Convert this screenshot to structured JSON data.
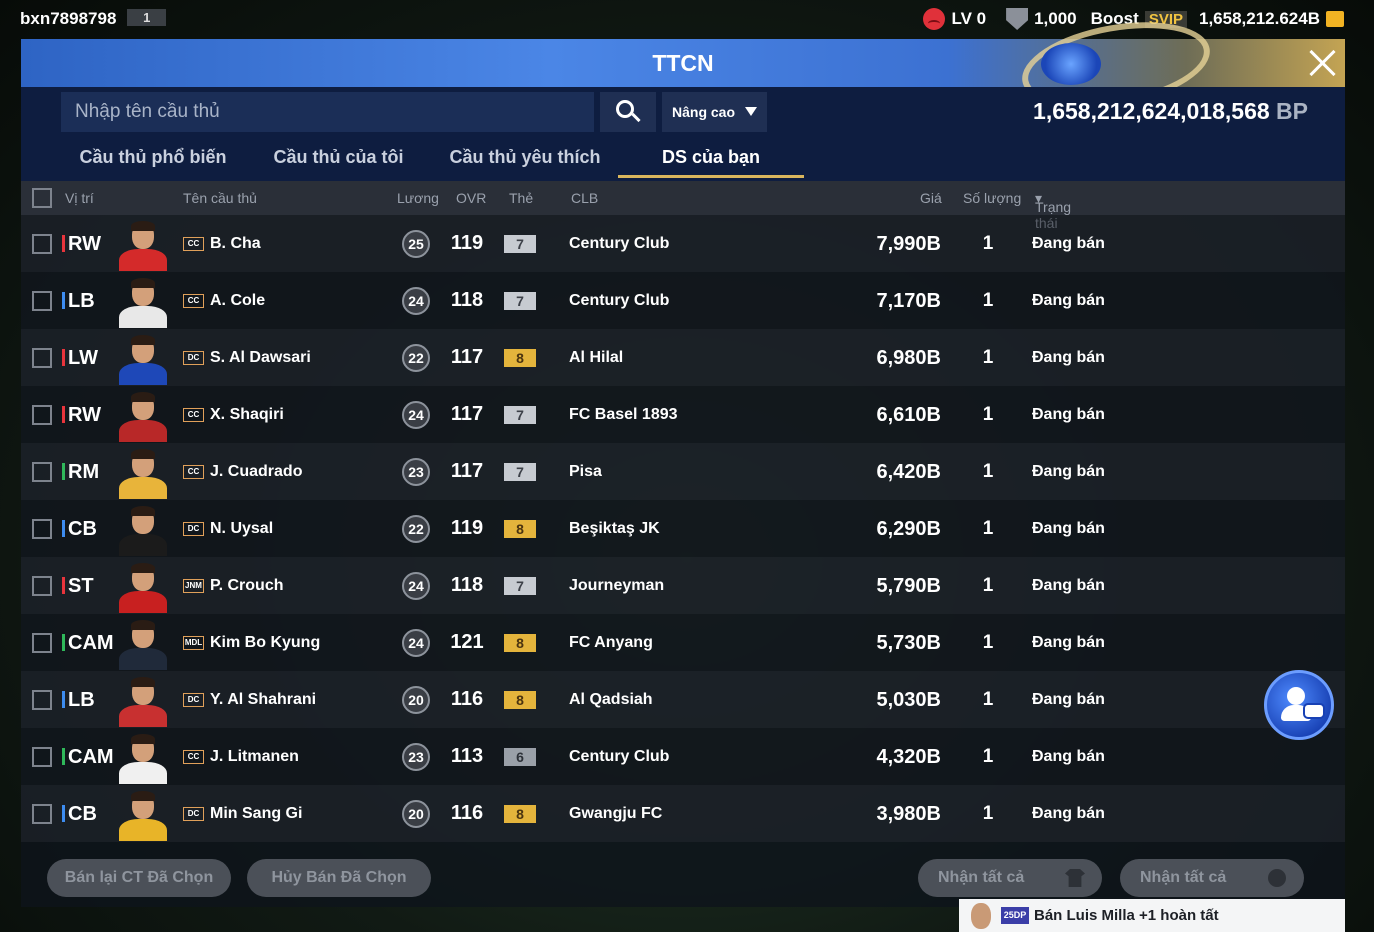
{
  "topbar": {
    "username": "bxn7898798",
    "user_badge": "1",
    "level": "LV 0",
    "shield_value": "1,000",
    "boost_label": "Boost",
    "svip_label": "SVIP",
    "currency": "1,658,212.624B"
  },
  "window": {
    "title": "TTCN"
  },
  "search": {
    "placeholder": "Nhập tên cầu thủ",
    "advanced_label": "Nâng cao",
    "bp_value": "1,658,212,624,018,568",
    "bp_unit": "BP"
  },
  "tabs": [
    {
      "label": "Cầu thủ phổ biến"
    },
    {
      "label": "Cầu thủ của tôi"
    },
    {
      "label": "Cầu thủ yêu thích"
    },
    {
      "label": "DS của bạn"
    }
  ],
  "columns": {
    "position": "Vị trí",
    "name": "Tên cầu thủ",
    "salary": "Lương",
    "ovr": "OVR",
    "grade": "Thẻ",
    "club": "CLB",
    "price": "Giá",
    "quantity": "Số lượng",
    "status": "Trạng thái"
  },
  "colors": {
    "attack": "#e8343c",
    "defense": "#3d8cf0",
    "midfield": "#2fb85a",
    "accent_gold": "#d9b65d"
  },
  "rows": [
    {
      "position": "RW",
      "pos_group": "attack",
      "season": "CC",
      "name": "B. Cha",
      "salary": "25",
      "ovr": "119",
      "grade": "7",
      "grade_color": "silver",
      "club": "Century Club",
      "price": "7,990B",
      "quantity": "1",
      "status": "Đang bán",
      "kit": "#d42a2a"
    },
    {
      "position": "LB",
      "pos_group": "defense",
      "season": "CC",
      "name": "A. Cole",
      "salary": "24",
      "ovr": "118",
      "grade": "7",
      "grade_color": "silver",
      "club": "Century Club",
      "price": "7,170B",
      "quantity": "1",
      "status": "Đang bán",
      "kit": "#e8e8e8"
    },
    {
      "position": "LW",
      "pos_group": "attack",
      "season": "DC",
      "name": "S. Al Dawsari",
      "salary": "22",
      "ovr": "117",
      "grade": "8",
      "grade_color": "gold",
      "club": "Al Hilal",
      "price": "6,980B",
      "quantity": "1",
      "status": "Đang bán",
      "kit": "#1e48b8"
    },
    {
      "position": "RW",
      "pos_group": "attack",
      "season": "CC",
      "name": "X. Shaqiri",
      "salary": "24",
      "ovr": "117",
      "grade": "7",
      "grade_color": "silver",
      "club": "FC Basel 1893",
      "price": "6,610B",
      "quantity": "1",
      "status": "Đang bán",
      "kit": "#b82828"
    },
    {
      "position": "RM",
      "pos_group": "midfield",
      "season": "CC",
      "name": "J. Cuadrado",
      "salary": "23",
      "ovr": "117",
      "grade": "7",
      "grade_color": "silver",
      "club": "Pisa",
      "price": "6,420B",
      "quantity": "1",
      "status": "Đang bán",
      "kit": "#e8b43a"
    },
    {
      "position": "CB",
      "pos_group": "defense",
      "season": "DC",
      "name": "N. Uysal",
      "salary": "22",
      "ovr": "119",
      "grade": "8",
      "grade_color": "gold",
      "club": "Beşiktaş JK",
      "price": "6,290B",
      "quantity": "1",
      "status": "Đang bán",
      "kit": "#1b1b1b"
    },
    {
      "position": "ST",
      "pos_group": "attack",
      "season": "JNM",
      "name": "P. Crouch",
      "salary": "24",
      "ovr": "118",
      "grade": "7",
      "grade_color": "silver",
      "club": "Journeyman",
      "price": "5,790B",
      "quantity": "1",
      "status": "Đang bán",
      "kit": "#c82020"
    },
    {
      "position": "CAM",
      "pos_group": "midfield",
      "season": "MDL",
      "name": "Kim Bo Kyung",
      "salary": "24",
      "ovr": "121",
      "grade": "8",
      "grade_color": "gold",
      "club": "FC Anyang",
      "price": "5,730B",
      "quantity": "1",
      "status": "Đang bán",
      "kit": "#202a3a"
    },
    {
      "position": "LB",
      "pos_group": "defense",
      "season": "DC",
      "name": "Y. Al Shahrani",
      "salary": "20",
      "ovr": "116",
      "grade": "8",
      "grade_color": "gold",
      "club": "Al Qadsiah",
      "price": "5,030B",
      "quantity": "1",
      "status": "Đang bán",
      "kit": "#c83030"
    },
    {
      "position": "CAM",
      "pos_group": "midfield",
      "season": "CC",
      "name": "J. Litmanen",
      "salary": "23",
      "ovr": "113",
      "grade": "6",
      "grade_color": "bronze",
      "club": "Century Club",
      "price": "4,320B",
      "quantity": "1",
      "status": "Đang bán",
      "kit": "#f0f0f0"
    },
    {
      "position": "CB",
      "pos_group": "defense",
      "season": "DC",
      "name": "Min Sang Gi",
      "salary": "20",
      "ovr": "116",
      "grade": "8",
      "grade_color": "gold",
      "club": "Gwangju FC",
      "price": "3,980B",
      "quantity": "1",
      "status": "Đang bán",
      "kit": "#e8b428"
    }
  ],
  "footer": {
    "resell_selected": "Bán lại CT Đã Chọn",
    "cancel_selected": "Hủy Bán Đã Chọn",
    "receive_all_1": "Nhận tất cả",
    "receive_all_2": "Nhận tất cả"
  },
  "toast": {
    "badge": "25DP",
    "text": "Bán Luis Milla +1 hoàn tất"
  },
  "icons": {
    "close": "close-icon",
    "search": "search-icon",
    "dropdown": "chevron-down-icon",
    "chat": "chat-icon",
    "shirt": "shirt-icon",
    "coin": "coin-icon"
  }
}
